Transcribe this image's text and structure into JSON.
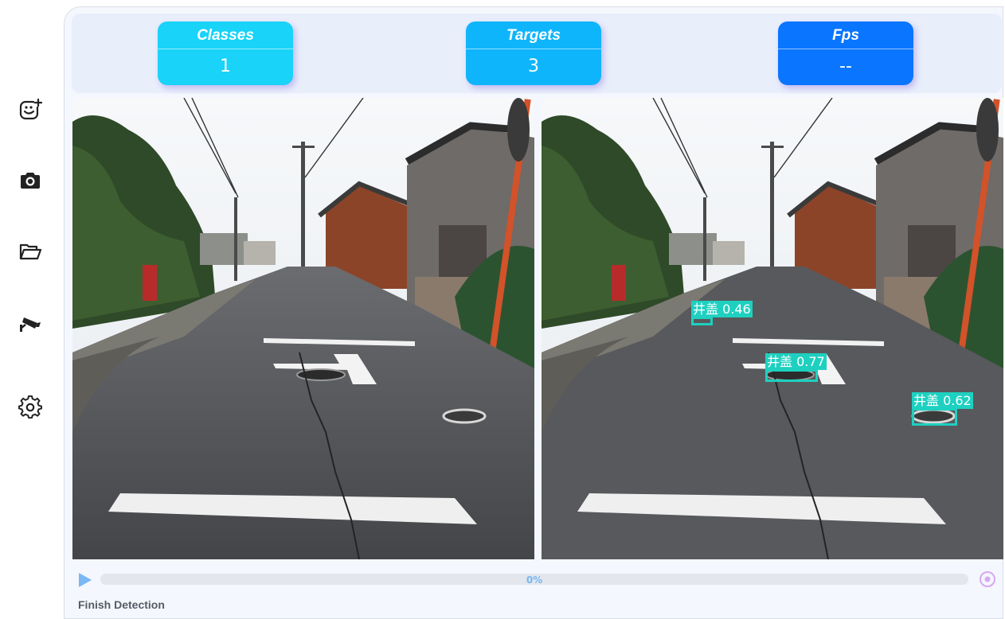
{
  "sidebar": {
    "items": [
      {
        "icon": "add-image-icon"
      },
      {
        "icon": "camera-icon"
      },
      {
        "icon": "folder-open-icon"
      },
      {
        "icon": "security-camera-icon"
      },
      {
        "icon": "gear-icon"
      }
    ]
  },
  "stats": {
    "classes": {
      "title": "Classes",
      "value": "1"
    },
    "targets": {
      "title": "Targets",
      "value": "3"
    },
    "fps": {
      "title": "Fps",
      "value": "--"
    }
  },
  "colors": {
    "detection_box": "#1ed0c0",
    "classes_card": "#19d3f8",
    "targets_card": "#0fb5fb",
    "fps_card": "#0a75ff",
    "accent": "#7cc0f8"
  },
  "detections": [
    {
      "label": "井盖 0.46"
    },
    {
      "label": "井盖 0.77"
    },
    {
      "label": "井盖 0.62"
    }
  ],
  "player": {
    "progress_text": "0%",
    "progress_value": 0
  },
  "status_text": "Finish Detection"
}
